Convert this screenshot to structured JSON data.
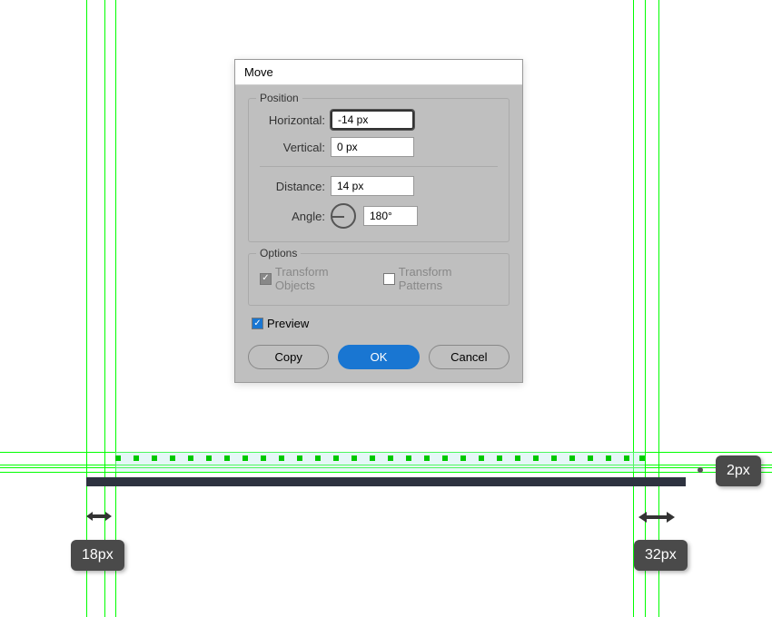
{
  "dialog": {
    "title": "Move",
    "position": {
      "legend": "Position",
      "horizontal_label": "Horizontal:",
      "horizontal_value": "-14 px",
      "vertical_label": "Vertical:",
      "vertical_value": "0 px",
      "distance_label": "Distance:",
      "distance_value": "14 px",
      "angle_label": "Angle:",
      "angle_value": "180°"
    },
    "options": {
      "legend": "Options",
      "transform_objects_label": "Transform Objects",
      "transform_patterns_label": "Transform Patterns",
      "transform_objects_checked": true,
      "transform_patterns_checked": false
    },
    "preview_label": "Preview",
    "preview_checked": true,
    "buttons": {
      "copy": "Copy",
      "ok": "OK",
      "cancel": "Cancel"
    }
  },
  "annotations": {
    "left_margin": "18px",
    "right_margin": "32px",
    "stroke": "2px"
  }
}
